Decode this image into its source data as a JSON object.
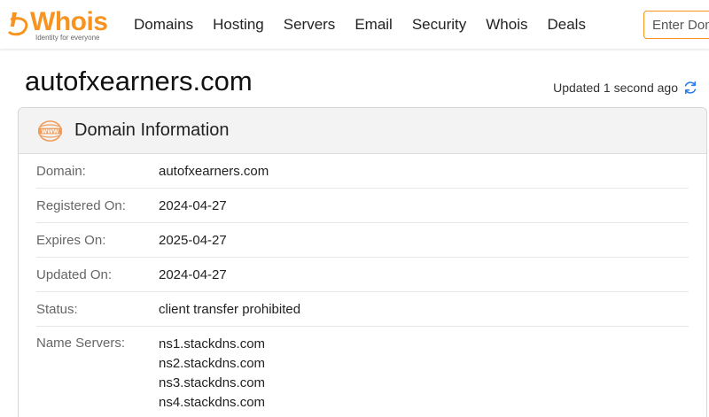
{
  "header": {
    "logo": {
      "word": "Whois",
      "tagline": "Identity for everyone"
    },
    "nav": [
      "Domains",
      "Hosting",
      "Servers",
      "Email",
      "Security",
      "Whois",
      "Deals"
    ],
    "search": {
      "placeholder": "Enter Domain",
      "value": ""
    }
  },
  "page": {
    "title": "autofxearners.com",
    "updated": "Updated 1 second ago"
  },
  "card": {
    "title": "Domain Information",
    "rows": [
      {
        "label": "Domain:",
        "value": "autofxearners.com"
      },
      {
        "label": "Registered On:",
        "value": "2024-04-27"
      },
      {
        "label": "Expires On:",
        "value": "2025-04-27"
      },
      {
        "label": "Updated On:",
        "value": "2024-04-27"
      },
      {
        "label": "Status:",
        "value": "client transfer prohibited"
      },
      {
        "label": "Name Servers:",
        "values": [
          "ns1.stackdns.com",
          "ns2.stackdns.com",
          "ns3.stackdns.com",
          "ns4.stackdns.com"
        ]
      }
    ]
  },
  "colors": {
    "brand": "#f7931e",
    "refresh": "#2b7de9"
  },
  "icons": [
    "logo-mark-icon",
    "refresh-icon",
    "www-globe-icon"
  ]
}
